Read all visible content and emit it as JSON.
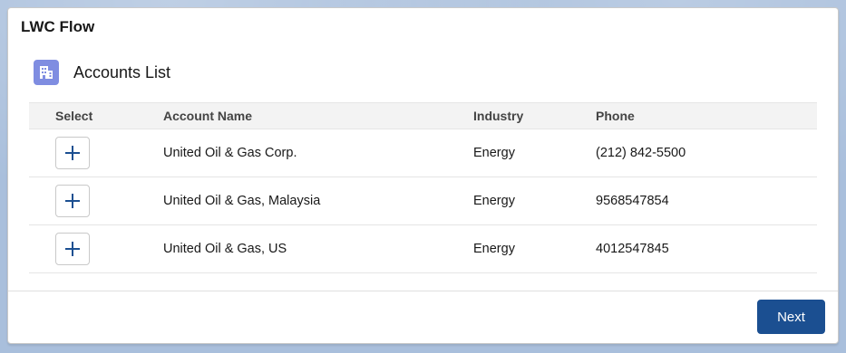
{
  "flow": {
    "title": "LWC Flow"
  },
  "list": {
    "title": "Accounts List",
    "icon": "account-building-icon",
    "icon_color": "#7f8de1"
  },
  "table": {
    "columns": [
      "Select",
      "Account Name",
      "Industry",
      "Phone"
    ],
    "rows": [
      {
        "name": "United Oil & Gas Corp.",
        "industry": "Energy",
        "phone": "(212) 842-5500"
      },
      {
        "name": "United Oil & Gas, Malaysia",
        "industry": "Energy",
        "phone": "9568547854"
      },
      {
        "name": "United Oil & Gas, US",
        "industry": "Energy",
        "phone": "4012547845"
      }
    ],
    "select_icon": "plus-icon"
  },
  "footer": {
    "next_label": "Next",
    "next_color": "#1b4f91"
  }
}
